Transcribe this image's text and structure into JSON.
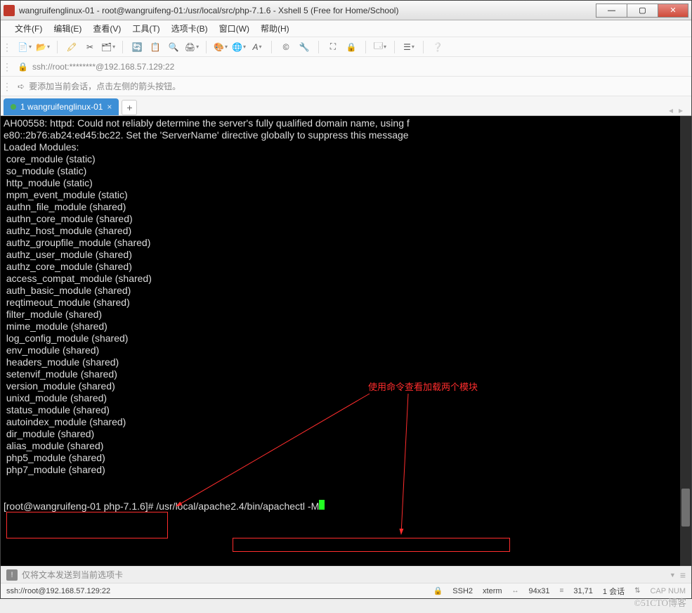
{
  "title": "wangruifenglinux-01 - root@wangruifeng-01:/usr/local/src/php-7.1.6 - Xshell 5 (Free for Home/School)",
  "menus": [
    "文件(F)",
    "编辑(E)",
    "查看(V)",
    "工具(T)",
    "选项卡(B)",
    "窗口(W)",
    "帮助(H)"
  ],
  "address_bar": {
    "prefix": "🔒",
    "text": "ssh://root:********@192.168.57.129:22"
  },
  "hint_bar": {
    "icon": "▸",
    "text": "要添加当前会话，点击左侧的箭头按钮。"
  },
  "tab": {
    "label": "1 wangruifenglinux-01"
  },
  "terminal": {
    "lines": [
      "AH00558: httpd: Could not reliably determine the server's fully qualified domain name, using f",
      "e80::2b76:ab24:ed45:bc22. Set the 'ServerName' directive globally to suppress this message",
      "Loaded Modules:",
      " core_module (static)",
      " so_module (static)",
      " http_module (static)",
      " mpm_event_module (static)",
      " authn_file_module (shared)",
      " authn_core_module (shared)",
      " authz_host_module (shared)",
      " authz_groupfile_module (shared)",
      " authz_user_module (shared)",
      " authz_core_module (shared)",
      " access_compat_module (shared)",
      " auth_basic_module (shared)",
      " reqtimeout_module (shared)",
      " filter_module (shared)",
      " mime_module (shared)",
      " log_config_module (shared)",
      " env_module (shared)",
      " headers_module (shared)",
      " setenvif_module (shared)",
      " version_module (shared)",
      " unixd_module (shared)",
      " status_module (shared)",
      " autoindex_module (shared)",
      " dir_module (shared)",
      " alias_module (shared)",
      " php5_module (shared)",
      " php7_module (shared)"
    ],
    "prompt": "[root@wangruifeng-01 php-7.1.6]# ",
    "command": "/usr/local/apache2.4/bin/apachectl -M"
  },
  "annotation": "使用命令查看加载两个模块",
  "sendbar": "仅将文本发送到当前选项卡",
  "status": {
    "left": "ssh://root@192.168.57.129:22",
    "ssh": "SSH2",
    "term": "xterm",
    "size": "94x31",
    "pos": "31,71",
    "sess": "1 会话",
    "cap": "CAP  NUM"
  },
  "watermark": "©51CTO博客"
}
